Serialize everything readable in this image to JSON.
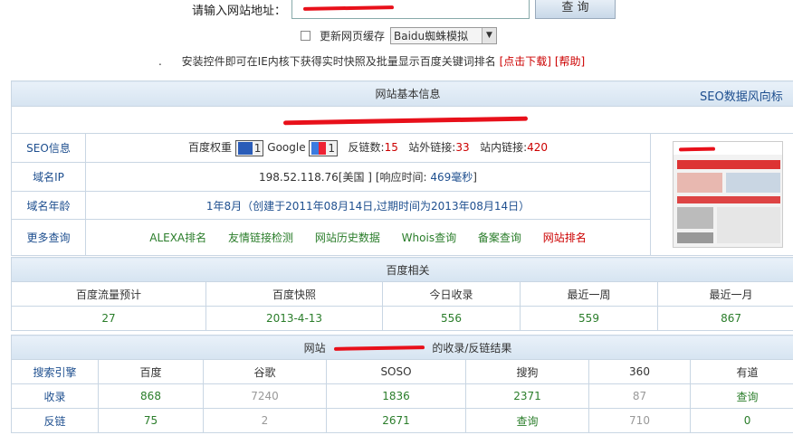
{
  "top": {
    "url_label": "请输入网站地址：",
    "url_value": "",
    "query_button": "查 询",
    "cache_label": "更新网页缓存",
    "spider_select": "Baidu蜘蛛模拟",
    "notice_text": "安装控件即可在IE内核下获得实时快照及批量显示百度关键词排名",
    "notice_download": "[点击下载]",
    "notice_help": "[帮助]"
  },
  "basic": {
    "title": "网站基本信息",
    "seo_link": "SEO数据风向标",
    "rows": {
      "seo_label": "SEO信息",
      "baidu_weight_label": "百度权重",
      "baidu_weight": "1",
      "google_label": "Google",
      "google_pr": "1",
      "backlinks_label": "反链数:",
      "backlinks": "15",
      "outlinks_label": "站外链接:",
      "outlinks": "33",
      "inlinks_label": "站内链接:",
      "inlinks": "420",
      "ip_label": "域名IP",
      "ip_value": "198.52.118.76[美国 ]",
      "resp_label": "[响应时间:",
      "resp_value": "469毫秒",
      "resp_close": "]",
      "age_label": "域名年龄",
      "age_value": "1年8月（创建于2011年08月14日,过期时间为2013年08月14日）",
      "more_label": "更多查询",
      "more_links": [
        "ALEXA排名",
        "友情链接检测",
        "网站历史数据",
        "Whois查询",
        "备案查询",
        "网站排名"
      ]
    }
  },
  "baidu": {
    "title": "百度相关",
    "headers": [
      "百度流量预计",
      "百度快照",
      "今日收录",
      "最近一周",
      "最近一月"
    ],
    "values": [
      "27",
      "2013-4-13",
      "556",
      "559",
      "867"
    ]
  },
  "index": {
    "title_prefix": "网站",
    "title_suffix": "的收录/反链结果",
    "headers": [
      "搜索引擎",
      "百度",
      "谷歌",
      "SOSO",
      "搜狗",
      "360",
      "有道"
    ],
    "row_index": [
      "收录",
      "868",
      "7240",
      "1836",
      "2371",
      "87",
      "查询"
    ],
    "row_back": [
      "反链",
      "75",
      "2",
      "2671",
      "查询",
      "710",
      "0"
    ]
  }
}
